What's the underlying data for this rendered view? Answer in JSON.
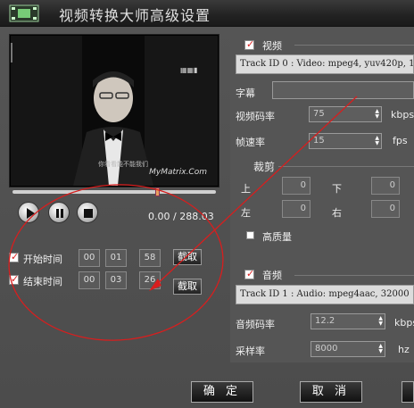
{
  "window": {
    "title": "视频转换大师高级设置"
  },
  "player": {
    "watermark": "MyMatrix.Com",
    "caption": "你看看能不能我们",
    "time_current": "0.00",
    "time_separator": "/",
    "time_total": "288.03",
    "progress": 0.75
  },
  "trim": {
    "start": {
      "label": "开始时间",
      "h": "00",
      "m": "01",
      "s": "58",
      "button": "截取"
    },
    "end": {
      "label": "结束时间",
      "h": "00",
      "m": "03",
      "s": "26",
      "button": "截取"
    }
  },
  "video": {
    "section_title": "视频",
    "track": "Track ID 0 : Video: mpeg4, yuv420p, 1",
    "subtitle_label": "字幕",
    "bitrate_label": "视频码率",
    "bitrate_value": "75",
    "bitrate_unit": "kbps",
    "fps_label": "帧速率",
    "fps_value": "15",
    "fps_unit": "fps",
    "crop": {
      "title": "裁剪",
      "top_label": "上",
      "top_value": "0",
      "bottom_label": "下",
      "bottom_value": "0",
      "left_label": "左",
      "left_value": "0",
      "right_label": "右",
      "right_value": "0"
    },
    "hq_label": "高质量"
  },
  "audio": {
    "section_title": "音频",
    "track": "Track ID 1 : Audio: mpeg4aac, 32000",
    "bitrate_label": "音频码率",
    "bitrate_value": "12.2",
    "bitrate_unit": "kbps",
    "samplerate_label": "采样率",
    "samplerate_value": "8000",
    "samplerate_unit": "hz"
  },
  "buttons": {
    "ok": "确 定",
    "cancel": "取 消"
  },
  "colors": {
    "annotation_red": "#d81e1e",
    "check_red": "#d22222"
  }
}
